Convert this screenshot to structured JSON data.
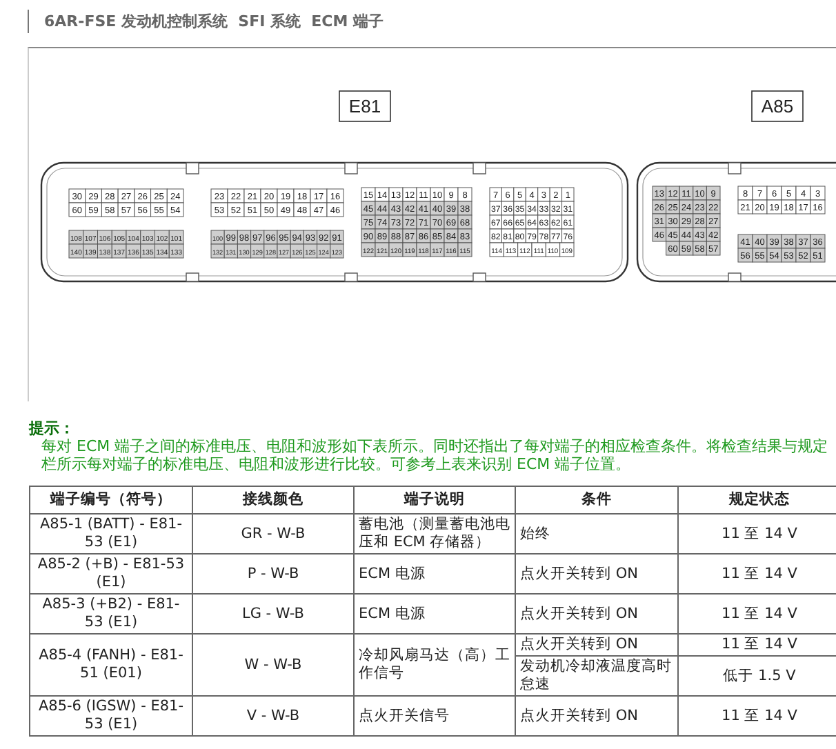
{
  "header": {
    "title": "6AR-FSE 发动机控制系统  SFI 系统  ECM 端子"
  },
  "connectors": [
    {
      "label": "E81",
      "blocks": [
        {
          "rows": [
            {
              "shaded": false,
              "pins": [
                "30",
                "29",
                "28",
                "27",
                "26",
                "25",
                "24"
              ]
            },
            {
              "shaded": false,
              "pins": [
                "60",
                "59",
                "58",
                "57",
                "56",
                "55",
                "54"
              ]
            },
            {
              "shaded": true,
              "pins": [
                "108",
                "107",
                "106",
                "105",
                "104",
                "103",
                "102",
                "101"
              ]
            },
            {
              "shaded": true,
              "pins": [
                "140",
                "139",
                "138",
                "137",
                "136",
                "135",
                "134",
                "133"
              ]
            }
          ]
        },
        {
          "rows": [
            {
              "shaded": false,
              "pins": [
                "23",
                "22",
                "21",
                "20",
                "19",
                "18",
                "17",
                "16"
              ]
            },
            {
              "shaded": false,
              "pins": [
                "53",
                "52",
                "51",
                "50",
                "49",
                "48",
                "47",
                "46"
              ]
            },
            {
              "shaded": true,
              "pins": [
                "100",
                "99",
                "98",
                "97",
                "96",
                "95",
                "94",
                "93",
                "92",
                "91"
              ]
            },
            {
              "shaded": true,
              "pins": [
                "132",
                "131",
                "130",
                "129",
                "128",
                "127",
                "126",
                "125",
                "124",
                "123"
              ]
            }
          ]
        },
        {
          "rows": [
            {
              "shaded": false,
              "pins": [
                "15",
                "14",
                "13",
                "12",
                "11",
                "10",
                "9",
                "8"
              ]
            },
            {
              "shaded": true,
              "pins": [
                "45",
                "44",
                "43",
                "42",
                "41",
                "40",
                "39",
                "38"
              ]
            },
            {
              "shaded": true,
              "pins": [
                "75",
                "74",
                "73",
                "72",
                "71",
                "70",
                "69",
                "68"
              ]
            },
            {
              "shaded": true,
              "pins": [
                "90",
                "89",
                "88",
                "87",
                "86",
                "85",
                "84",
                "83"
              ]
            },
            {
              "shaded": true,
              "pins": [
                "122",
                "121",
                "120",
                "119",
                "118",
                "117",
                "116",
                "115"
              ]
            }
          ]
        },
        {
          "rows": [
            {
              "shaded": false,
              "pins": [
                "7",
                "6",
                "5",
                "4",
                "3",
                "2",
                "1"
              ]
            },
            {
              "shaded": false,
              "pins": [
                "37",
                "36",
                "35",
                "34",
                "33",
                "32",
                "31"
              ]
            },
            {
              "shaded": false,
              "pins": [
                "67",
                "66",
                "65",
                "64",
                "63",
                "62",
                "61"
              ]
            },
            {
              "shaded": false,
              "pins": [
                "82",
                "81",
                "80",
                "79",
                "78",
                "77",
                "76"
              ]
            },
            {
              "shaded": false,
              "pins": [
                "114",
                "113",
                "112",
                "111",
                "110",
                "109"
              ]
            }
          ]
        }
      ]
    },
    {
      "label": "A85",
      "blocks": [
        {
          "rows": [
            {
              "shaded": true,
              "pins": [
                "13",
                "12",
                "11",
                "10",
                "9"
              ]
            },
            {
              "shaded": true,
              "pins": [
                "26",
                "25",
                "24",
                "23",
                "22"
              ]
            },
            {
              "shaded": true,
              "pins": [
                "31",
                "30",
                "29",
                "28",
                "27"
              ]
            },
            {
              "shaded": true,
              "pins": [
                "46",
                "45",
                "44",
                "43",
                "42"
              ]
            },
            {
              "shaded": true,
              "pins": [
                "60",
                "59",
                "58",
                "57"
              ]
            }
          ]
        },
        {
          "rows": [
            {
              "shaded": false,
              "pins": [
                "8",
                "7",
                "6",
                "5",
                "4",
                "3"
              ]
            },
            {
              "shaded": false,
              "pins": [
                "21",
                "20",
                "19",
                "18",
                "17",
                "16"
              ]
            },
            {
              "shaded": true,
              "pins": [
                "41",
                "40",
                "39",
                "38",
                "37",
                "36"
              ]
            },
            {
              "shaded": true,
              "pins": [
                "56",
                "55",
                "54",
                "53",
                "52",
                "51"
              ]
            }
          ]
        }
      ]
    }
  ],
  "hint": {
    "title": "提示：",
    "lines": [
      "每对 ECM 端子之间的标准电压、电阻和波形如下表所示。同时还指出了每对端子的相应检查条件。将检查结果与规定",
      "栏所示每对端子的标准电压、电阻和波形进行比较。可参考上表来识别 ECM 端子位置。"
    ]
  },
  "table": {
    "columns": [
      "端子编号（符号）",
      "接线颜色",
      "端子说明",
      "条件",
      "规定状态"
    ],
    "rows": [
      {
        "terminal": "A85-1 (BATT) - E81-53 (E1)",
        "wire_color": "GR - W-B",
        "description": "蓄电池（测量蓄电池电压和 ECM 存储器）",
        "conditions": [
          {
            "condition": "始终",
            "spec": "11 至 14 V"
          }
        ]
      },
      {
        "terminal": "A85-2 (+B) - E81-53 (E1)",
        "wire_color": "P - W-B",
        "description": "ECM 电源",
        "conditions": [
          {
            "condition": "点火开关转到 ON",
            "spec": "11 至 14 V"
          }
        ]
      },
      {
        "terminal": "A85-3 (+B2) - E81-53 (E1)",
        "wire_color": "LG - W-B",
        "description": "ECM 电源",
        "conditions": [
          {
            "condition": "点火开关转到 ON",
            "spec": "11 至 14 V"
          }
        ]
      },
      {
        "terminal": "A85-4 (FANH) - E81-51 (E01)",
        "wire_color": "W - W-B",
        "description": "冷却风扇马达（高）工作信号",
        "conditions": [
          {
            "condition": "点火开关转到 ON",
            "spec": "11 至 14 V"
          },
          {
            "condition": "发动机冷却液温度高时怠速",
            "spec": "低于 1.5 V"
          }
        ]
      },
      {
        "terminal": "A85-6 (IGSW) - E81-53 (E1)",
        "wire_color": "V - W-B",
        "description": "点火开关信号",
        "conditions": [
          {
            "condition": "点火开关转到 ON",
            "spec": "11 至 14 V"
          }
        ]
      }
    ]
  }
}
